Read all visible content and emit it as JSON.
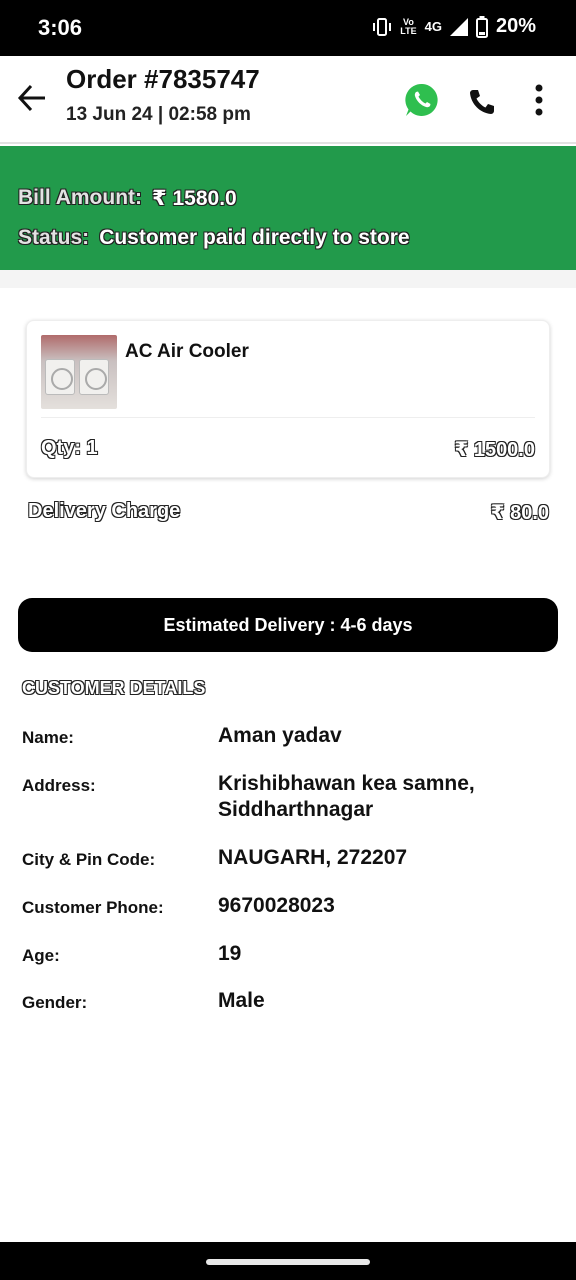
{
  "status_bar": {
    "time": "3:06",
    "volte_top": "Vo",
    "volte_bottom": "LTE",
    "network": "4G",
    "battery": "20%"
  },
  "header": {
    "title": "Order #7835747",
    "date": "13 Jun 24 | 02:58 pm",
    "icons": [
      "back-arrow-icon",
      "whatsapp-icon",
      "phone-icon",
      "more-vertical-icon"
    ]
  },
  "banner": {
    "bill_label": "Bill Amount:",
    "bill_value": "₹ 1580.0",
    "status_label": "Status:",
    "status_value": "Customer paid directly to store",
    "color": "#229a4b"
  },
  "product": {
    "name": "AC Air Cooler",
    "qty": "Qty: 1",
    "price": "₹ 1500.0"
  },
  "delivery_charge": {
    "label": "Delivery Charge",
    "value": "₹ 80.0"
  },
  "eta": "Estimated Delivery : 4-6 days",
  "customer": {
    "heading": "CUSTOMER DETAILS",
    "rows": [
      {
        "label": "Name:",
        "value": "Aman yadav"
      },
      {
        "label": "Address:",
        "value": "Krishibhawan kea samne, Siddharthnagar"
      },
      {
        "label": "City & Pin Code:",
        "value": "NAUGARH, 272207"
      },
      {
        "label": "Customer Phone:",
        "value": "9670028023"
      },
      {
        "label": "Age:",
        "value": "19"
      },
      {
        "label": "Gender:",
        "value": "Male"
      }
    ]
  }
}
